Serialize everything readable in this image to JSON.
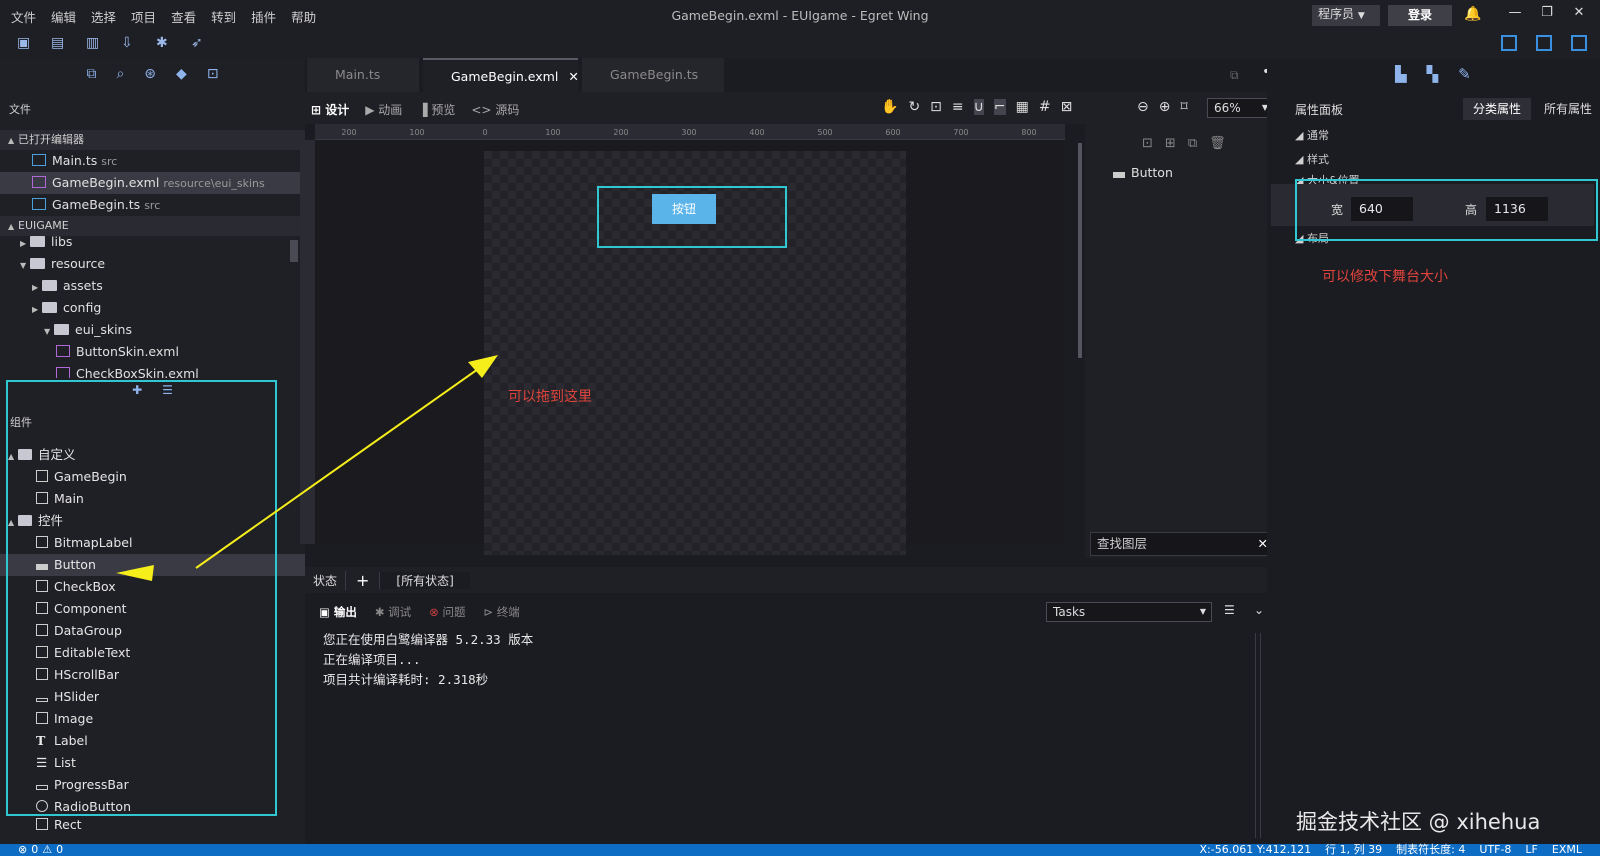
{
  "menu": [
    "文件",
    "编辑",
    "选择",
    "项目",
    "查看",
    "转到",
    "插件",
    "帮助"
  ],
  "window_title": "GameBegin.exml - EUIgame - Egret Wing",
  "header": {
    "role": "程序员",
    "login": "登录"
  },
  "left": {
    "section_files": "文件",
    "open_editors_header": "已打开编辑器",
    "open_editors": [
      {
        "name": "Main.ts",
        "sub": "src"
      },
      {
        "name": "GameBegin.exml",
        "sub": "resource\\eui_skins"
      },
      {
        "name": "GameBegin.ts",
        "sub": "src"
      }
    ],
    "project_header": "EUIGAME",
    "tree": [
      "libs",
      "resource",
      "assets",
      "config",
      "eui_skins",
      "ButtonSkin.exml",
      "CheckBoxSkin.exml"
    ],
    "components_title": "组件",
    "groups": {
      "custom": "自定义",
      "custom_items": [
        "GameBegin",
        "Main"
      ],
      "controls": "控件",
      "control_items": [
        "BitmapLabel",
        "Button",
        "CheckBox",
        "Component",
        "DataGroup",
        "EditableText",
        "HScrollBar",
        "HSlider",
        "Image",
        "Label",
        "List",
        "ProgressBar",
        "RadioButton",
        "Rect"
      ]
    }
  },
  "editor": {
    "tabs": [
      "Main.ts",
      "GameBegin.exml",
      "GameBegin.ts"
    ],
    "modes": [
      "设计",
      "动画",
      "预览",
      "源码"
    ],
    "zoom": "66%",
    "ruler_h": [
      "200",
      "100",
      "0",
      "100",
      "200",
      "300",
      "400",
      "500",
      "600",
      "700",
      "800"
    ],
    "stage_button": "按钮",
    "drag_note": "可以拖到这里",
    "layer_item": "Button",
    "layer_search": "查找图层",
    "state_label": "状态",
    "state_all": "[所有状态]"
  },
  "output": {
    "tabs": [
      "输出",
      "调试",
      "问题",
      "终端"
    ],
    "tasks": "Tasks",
    "lines": [
      "您正在使用白鹭编译器 5.2.33 版本",
      "正在编译项目...",
      "项目共计编译耗时: 2.318秒"
    ]
  },
  "props": {
    "title": "属性面板",
    "tab_category": "分类属性",
    "tab_all": "所有属性",
    "sections": [
      "通常",
      "样式",
      "大小&位置",
      "布局"
    ],
    "width_label": "宽",
    "width_value": "640",
    "height_label": "高",
    "height_value": "1136",
    "note": "可以修改下舞台大小"
  },
  "status": {
    "errors": "0",
    "warnings": "0",
    "coords": "X:-56.061 Y:412.121",
    "position": "行 1, 列 39",
    "tab_size": "制表符长度: 4",
    "encoding": "UTF-8",
    "eol": "LF",
    "lang": "EXML"
  },
  "watermark": "掘金技术社区 @ xihehua",
  "colors": {
    "accent_cyan": "#30c7d2",
    "arrow_yellow": "#f5ee1a",
    "note_red": "#e0443c",
    "status_blue": "#0d6cc4",
    "button_blue": "#5ab4ea"
  }
}
